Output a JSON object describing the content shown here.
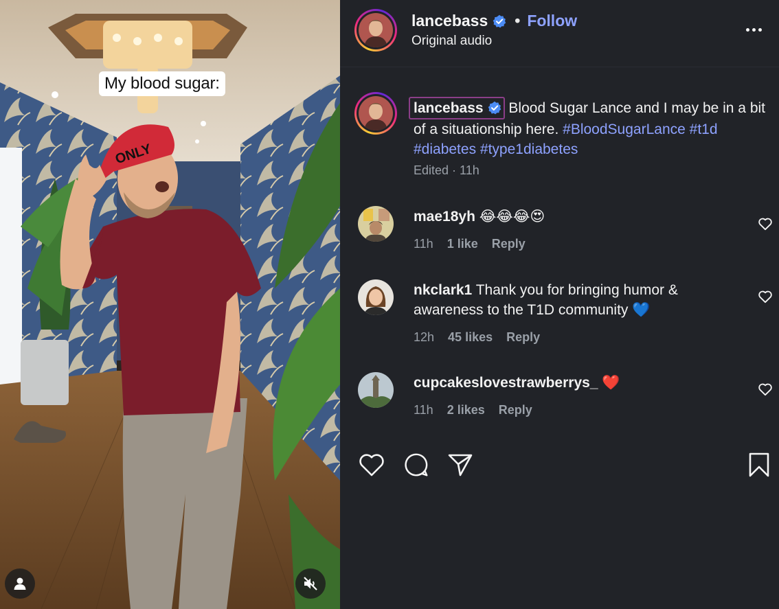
{
  "video": {
    "overlay_text": "My blood sugar:",
    "cap_text": "ONLY",
    "user_tag_icon": "person-icon",
    "mute_icon": "speaker-muted-icon"
  },
  "header": {
    "username": "lancebass",
    "verified_icon": "verified-badge-icon",
    "separator": "•",
    "follow_label": "Follow",
    "audio_label": "Original audio",
    "more_icon": "more-options-icon"
  },
  "caption": {
    "username": "lancebass",
    "text": "Blood Sugar Lance and I may be in a bit of a situationship here.",
    "hashtags": [
      "#BloodSugarLance",
      "#t1d",
      "#diabetes",
      "#type1diabetes"
    ],
    "meta": "Edited · 11h"
  },
  "comments": [
    {
      "username": "mae18yh",
      "text": "😂😂😂😍",
      "time": "11h",
      "likes": "1 like",
      "reply": "Reply"
    },
    {
      "username": "nkclark1",
      "text": "Thank you for bringing humor & awareness to the T1D community 💙",
      "time": "12h",
      "likes": "45 likes",
      "reply": "Reply"
    },
    {
      "username": "cupcakeslovestrawberrys_",
      "text": "❤️",
      "time": "11h",
      "likes": "2 likes",
      "reply": "Reply"
    }
  ],
  "actions": {
    "like_icon": "heart-icon",
    "comment_icon": "comment-icon",
    "share_icon": "share-icon",
    "save_icon": "bookmark-icon"
  },
  "colors": {
    "panel_bg": "#212328",
    "link_blue": "#8ea2ff",
    "muted_text": "#9aa0a8",
    "verified_blue": "#4c8cf5"
  }
}
